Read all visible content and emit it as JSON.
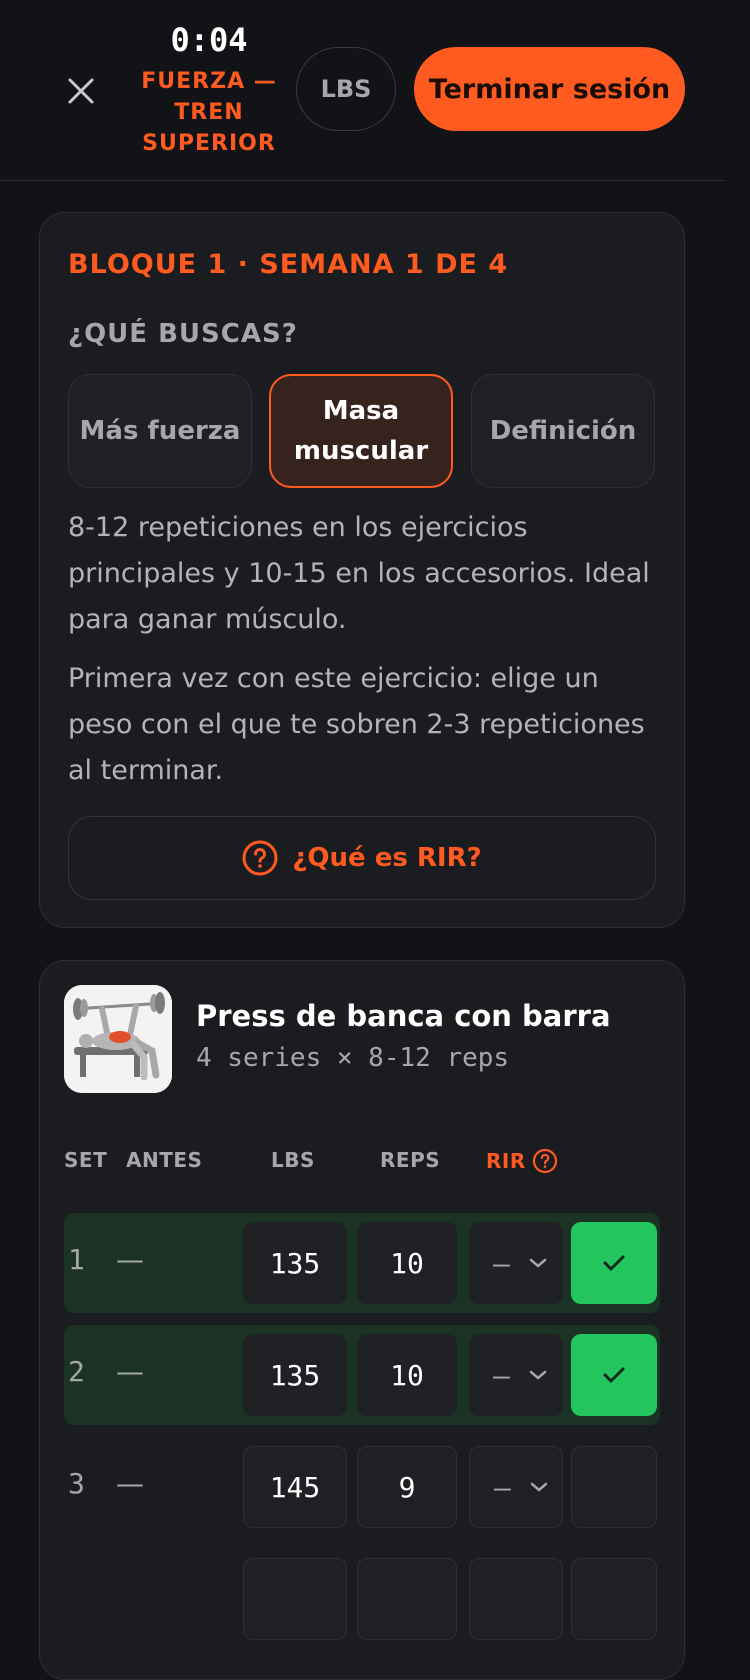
{
  "header": {
    "timer": "0:04",
    "session_title": "FUERZA — TREN SUPERIOR",
    "unit": "LBS",
    "end_label": "Terminar sesión"
  },
  "plan_card": {
    "block_label": "BLOQUE 1 · SEMANA 1 DE 4",
    "question": "¿QUÉ BUSCAS?",
    "goals": [
      {
        "label": "Más fuerza",
        "selected": false
      },
      {
        "label": "Masa muscular",
        "selected": true
      },
      {
        "label": "Definición",
        "selected": false
      }
    ],
    "description": "8-12 repeticiones en los ejercicios principales y 10-15 en los accesorios. Ideal para ganar músculo.",
    "first_time_tip": "Primera vez con este ejercicio: elige un peso con el que te sobren 2-3 repeticiones al terminar.",
    "rir_link": "¿Qué es RIR?"
  },
  "exercise": {
    "name": "Press de banca con barra",
    "prescription": "4 series × 8-12 reps",
    "columns": {
      "set": "SET",
      "before": "ANTES",
      "weight": "LBS",
      "reps": "REPS",
      "rir": "RIR"
    },
    "sets": [
      {
        "num": "1",
        "before": "—",
        "weight": "135",
        "reps": "10",
        "rir": "—",
        "done": true
      },
      {
        "num": "2",
        "before": "—",
        "weight": "135",
        "reps": "10",
        "rir": "—",
        "done": true
      },
      {
        "num": "3",
        "before": "—",
        "weight": "145",
        "reps": "9",
        "rir": "—",
        "done": false
      }
    ]
  },
  "colors": {
    "accent": "#ff5a1f",
    "success": "#22c55e",
    "background": "#121316",
    "card": "#1b1c20",
    "done_row": "#1a3324"
  },
  "icons": [
    "close-icon",
    "help-circle-icon",
    "chevron-down-icon",
    "check-icon"
  ]
}
